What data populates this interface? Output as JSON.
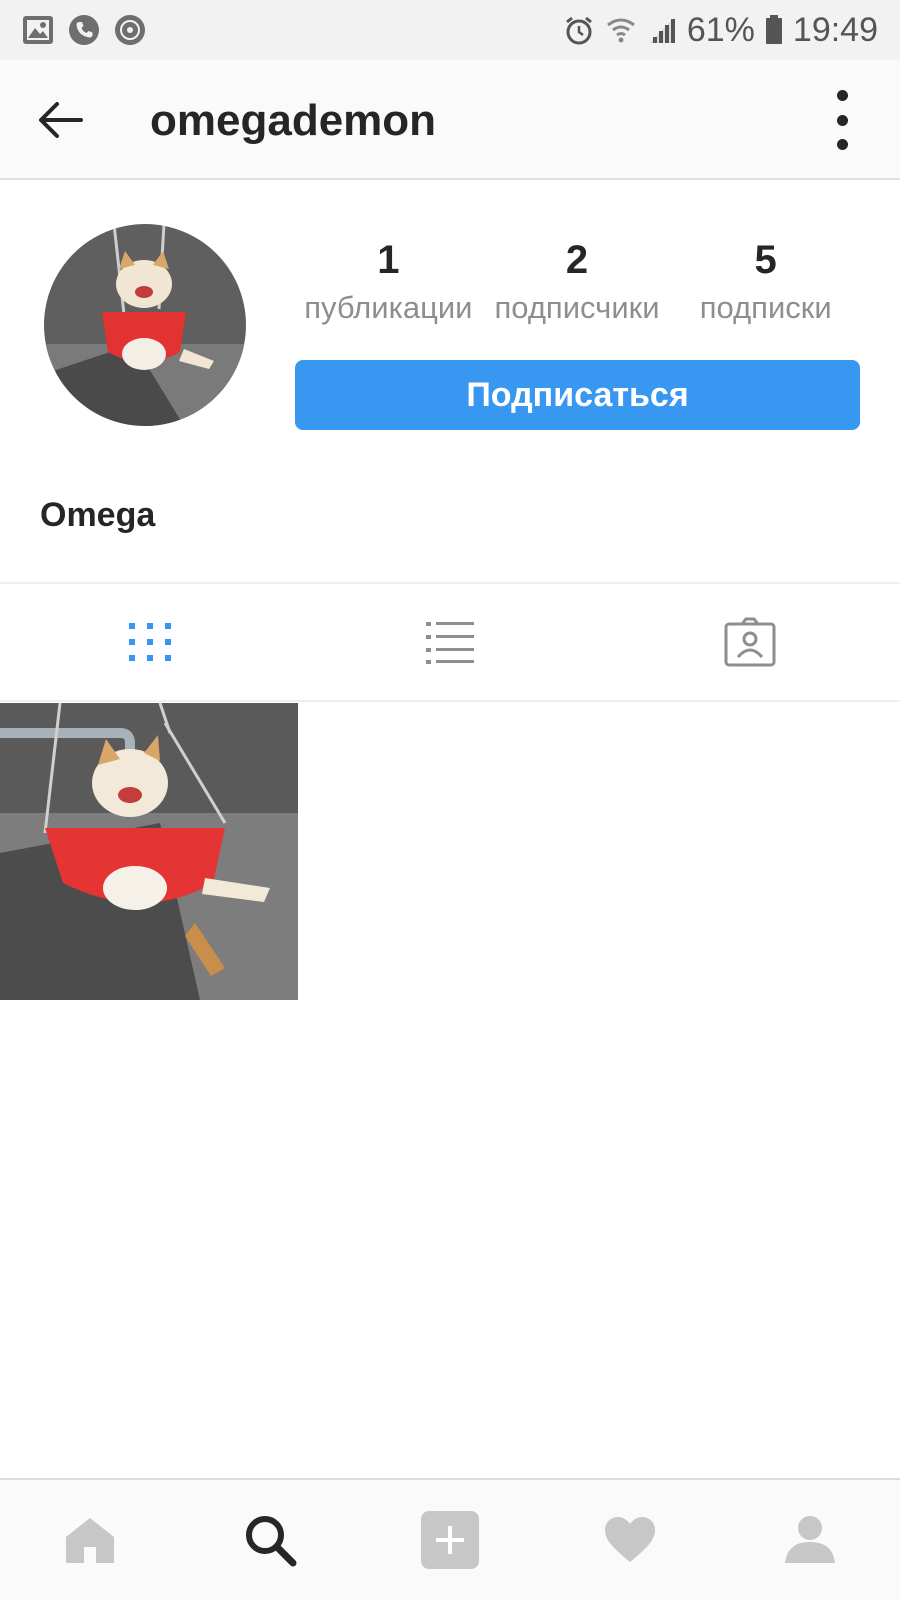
{
  "status_bar": {
    "icons_left": [
      "gallery-icon",
      "phone-icon",
      "shield-icon"
    ],
    "icons_right": [
      "alarm-icon",
      "wifi-icon",
      "signal-icon",
      "battery-icon"
    ],
    "battery": "61%",
    "time": "19:49"
  },
  "header": {
    "username": "omegademon"
  },
  "profile": {
    "stats": [
      {
        "value": "1",
        "label": "публикации"
      },
      {
        "value": "2",
        "label": "подписчики"
      },
      {
        "value": "5",
        "label": "подписки"
      }
    ],
    "follow_label": "Подписаться",
    "display_name": "Omega"
  },
  "tabs": [
    "grid-icon",
    "list-icon",
    "tagged-icon"
  ],
  "active_tab": "grid",
  "bottom_nav": [
    "home-icon",
    "search-icon",
    "add-post-icon",
    "activity-heart-icon",
    "profile-icon"
  ],
  "colors": {
    "accent": "#3897f0",
    "text": "#262626",
    "secondary_text": "#8e8e8e",
    "inactive_icon": "#c7c7c7"
  }
}
